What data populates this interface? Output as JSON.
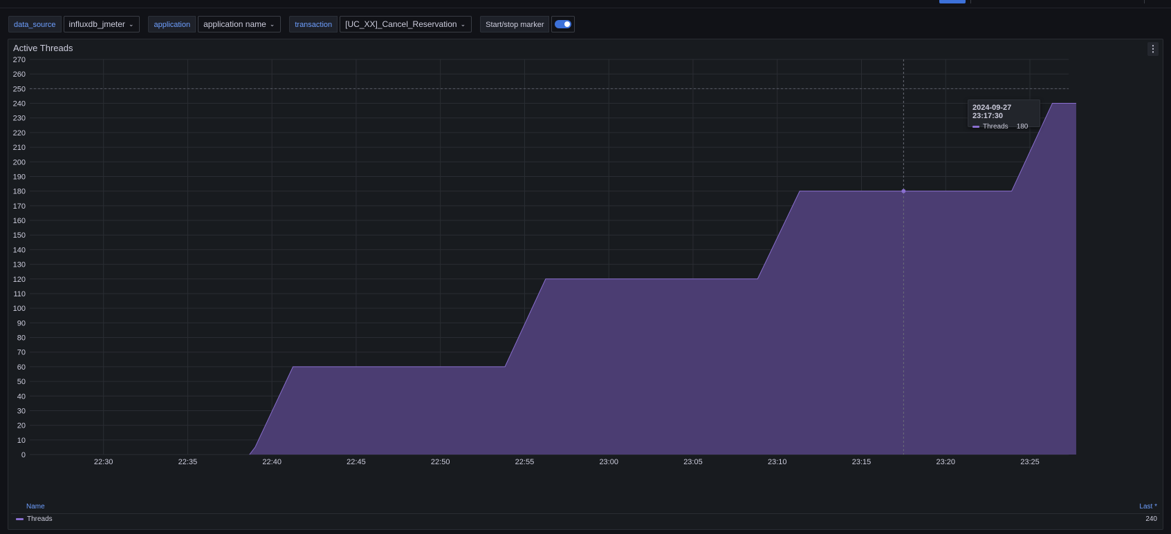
{
  "variables": [
    {
      "name": "data_source",
      "value": "influxdb_jmeter"
    },
    {
      "name": "application",
      "value": "application name"
    },
    {
      "name": "transaction",
      "value": "[UC_XX]_Cancel_Reservation"
    }
  ],
  "marker_switch": {
    "label": "Start/stop marker",
    "on": true
  },
  "panel": {
    "title": "Active Threads",
    "menu_icon": "kebab-menu-icon"
  },
  "tooltip": {
    "time": "2024-09-27 23:17:30",
    "series": "Threads",
    "value": "180"
  },
  "legend": {
    "name_header": "Name",
    "last_header": "Last *",
    "series": "Threads",
    "last_value": "240"
  },
  "colors": {
    "series": "#8a6fd0",
    "fill": "#4b3d72",
    "accent": "#3d71d9",
    "link": "#6e9fff"
  },
  "chart_data": {
    "type": "area",
    "title": "Active Threads",
    "x_ticks": [
      "22:30",
      "22:35",
      "22:40",
      "22:45",
      "22:50",
      "22:55",
      "23:00",
      "23:05",
      "23:10",
      "23:15",
      "23:20",
      "23:25"
    ],
    "y_ticks": [
      0,
      10,
      20,
      30,
      40,
      50,
      60,
      70,
      80,
      90,
      100,
      110,
      120,
      130,
      140,
      150,
      160,
      170,
      180,
      190,
      200,
      210,
      220,
      230,
      240,
      250,
      260,
      270
    ],
    "ylim": [
      0,
      270
    ],
    "xlim_minutes": [
      "22:26",
      "23:28"
    ],
    "threshold": 250,
    "grid": true,
    "series": [
      {
        "name": "Threads",
        "points": [
          [
            "22:38:40",
            0
          ],
          [
            "22:39",
            5
          ],
          [
            "22:41:15",
            60
          ],
          [
            "22:53:50",
            60
          ],
          [
            "22:56:15",
            120
          ],
          [
            "23:08:50",
            120
          ],
          [
            "23:11:20",
            180
          ],
          [
            "23:23:55",
            180
          ],
          [
            "23:26:20",
            240
          ],
          [
            "23:27:45",
            240
          ]
        ]
      }
    ],
    "hover": {
      "time": "23:17:30",
      "value": 180
    }
  }
}
